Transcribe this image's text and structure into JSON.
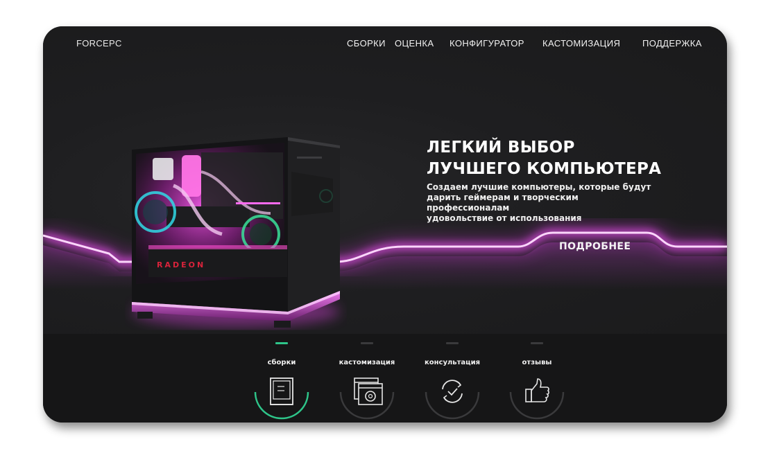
{
  "brand": {
    "logo": "FORCEPC"
  },
  "nav": [
    {
      "label": "СБОРКИ"
    },
    {
      "label": "ОЦЕНКА"
    },
    {
      "label": "КОНФИГУРАТОР"
    },
    {
      "label": "КАСТОМИЗАЦИЯ"
    },
    {
      "label": "ПОДДЕРЖКА"
    }
  ],
  "hero": {
    "headline_line1": "ЛЕГКИЙ ВЫБОР",
    "headline_line2": "ЛУЧШЕГО КОМПЬЮТЕРА",
    "subtext_line1": "Создаем лучшие компьютеры, которые будут",
    "subtext_line2": "дарить геймерам и творческим профессионалам",
    "subtext_line3": "удовольствие от использования",
    "cta": "ПОДРОБНЕЕ",
    "product_label": "RADEON"
  },
  "features": [
    {
      "label": "сборки",
      "icon": "pc-case-icon",
      "active": true
    },
    {
      "label": "кастомизация",
      "icon": "settings-window-icon",
      "active": false
    },
    {
      "label": "консультация",
      "icon": "refresh-check-icon",
      "active": false
    },
    {
      "label": "отзывы",
      "icon": "thumbs-up-icon",
      "active": false
    }
  ],
  "colors": {
    "neon": "#e14fe6",
    "accent": "#2ec58a",
    "card_bg": "#1c1c1e",
    "bottom_bg": "#161617"
  }
}
